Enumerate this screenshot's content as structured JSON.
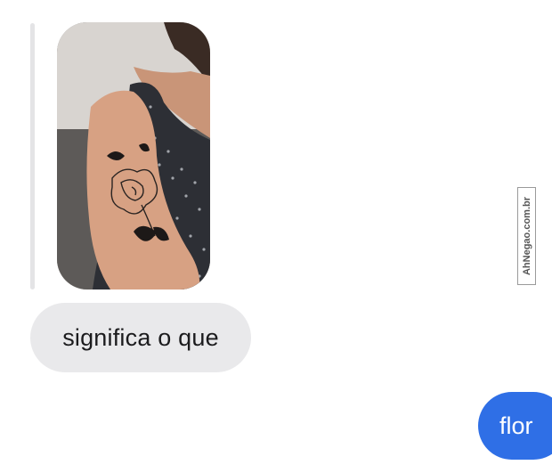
{
  "conversation": {
    "shared_photo": {
      "alt": "tattoo photo"
    },
    "messages": [
      {
        "direction": "incoming",
        "text": "significa o que"
      },
      {
        "direction": "outgoing",
        "text": "flor"
      }
    ]
  },
  "watermark": {
    "text": "AhNegao.com.br"
  },
  "colors": {
    "incoming_bubble": "#e9e9eb",
    "outgoing_bubble": "#2f6fe6",
    "reply_bar": "#e4e4e6"
  }
}
